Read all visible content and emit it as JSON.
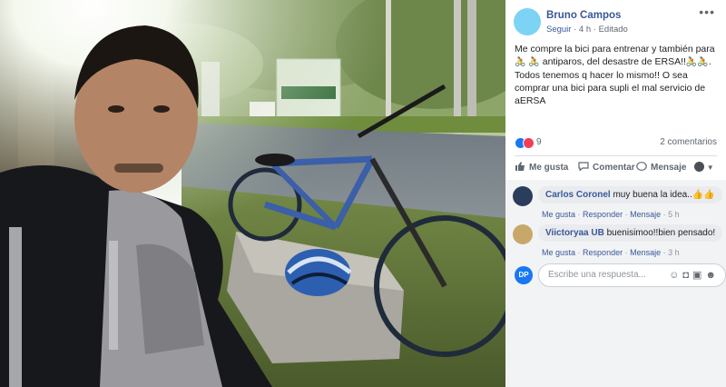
{
  "post": {
    "author": "Bruno Campos",
    "follow_label": "Seguir",
    "time": "4 h",
    "edited_label": "Editado",
    "text_parts": [
      "Me compre la bici para entrenar y también para",
      "antiparos, del desastre de ERSA!!",
      "Todos tenemos q hacer lo mismo!! O sea comprar una bici para supli el mal servicio de aERSA"
    ],
    "bike_emoji": "🚴"
  },
  "reactions": {
    "count": "9",
    "comments_label": "2 comentarios"
  },
  "actions": {
    "like": "Me gusta",
    "comment": "Comentar",
    "message": "Mensaje"
  },
  "comments": [
    {
      "name": "Carlos Coronel",
      "text": "muy buena la idea..👍👍",
      "like": "Me gusta",
      "reply": "Responder",
      "message": "Mensaje",
      "time": "5 h"
    },
    {
      "name": "Viictoryaa UB",
      "text": "buenisimoo!!bien pensado!",
      "like": "Me gusta",
      "reply": "Responder",
      "message": "Mensaje",
      "time": "3 h"
    }
  ],
  "reply_box": {
    "avatar_text": "DP",
    "placeholder": "Escribe una respuesta..."
  },
  "colors": {
    "link": "#385898",
    "like": "#1877f2",
    "love": "#f33e58",
    "panel_bg": "#f2f3f5"
  }
}
